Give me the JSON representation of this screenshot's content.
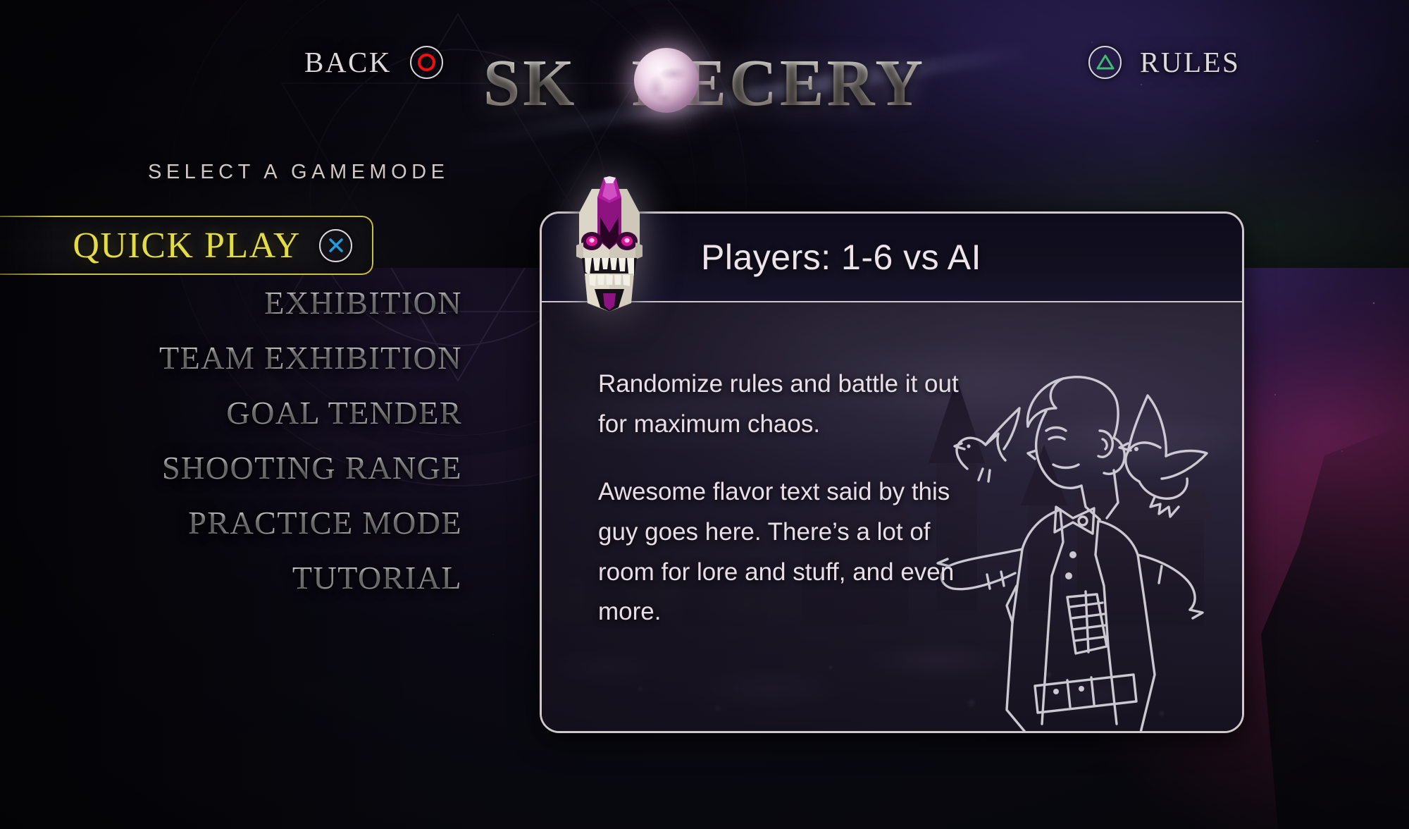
{
  "game": {
    "logo_text": "SKORECERY",
    "logo_pre": "SK",
    "logo_post": "RECERY"
  },
  "topbar": {
    "back_label": "BACK",
    "back_icon": "playstation-circle-icon",
    "back_icon_color": "#ef1111",
    "rules_label": "RULES",
    "rules_icon": "playstation-triangle-icon",
    "rules_icon_color": "#3fba76"
  },
  "menu": {
    "heading": "SELECT A GAMEMODE",
    "selected_index": 0,
    "confirm_icon": "playstation-cross-icon",
    "confirm_icon_color": "#1f9fe0",
    "highlight_color": "#e4dc47",
    "items": [
      {
        "label": "QUICK PLAY",
        "selected": true
      },
      {
        "label": "EXHIBITION",
        "selected": false
      },
      {
        "label": "TEAM EXHIBITION",
        "selected": false
      },
      {
        "label": "GOAL TENDER",
        "selected": false
      },
      {
        "label": "SHOOTING RANGE",
        "selected": false
      },
      {
        "label": "PRACTICE MODE",
        "selected": false
      },
      {
        "label": "TUTORIAL",
        "selected": false
      }
    ]
  },
  "panel": {
    "badge_icon": "crystal-skull-icon",
    "title": "Players: 1-6 vs AI",
    "paragraphs": [
      "Randomize rules and battle it out for maximum chaos.",
      "Awesome flavor text said by this guy goes here. There’s a lot of room for lore and stuff, and even more."
    ],
    "character_art": "gentleman-with-ravens-illustration"
  }
}
